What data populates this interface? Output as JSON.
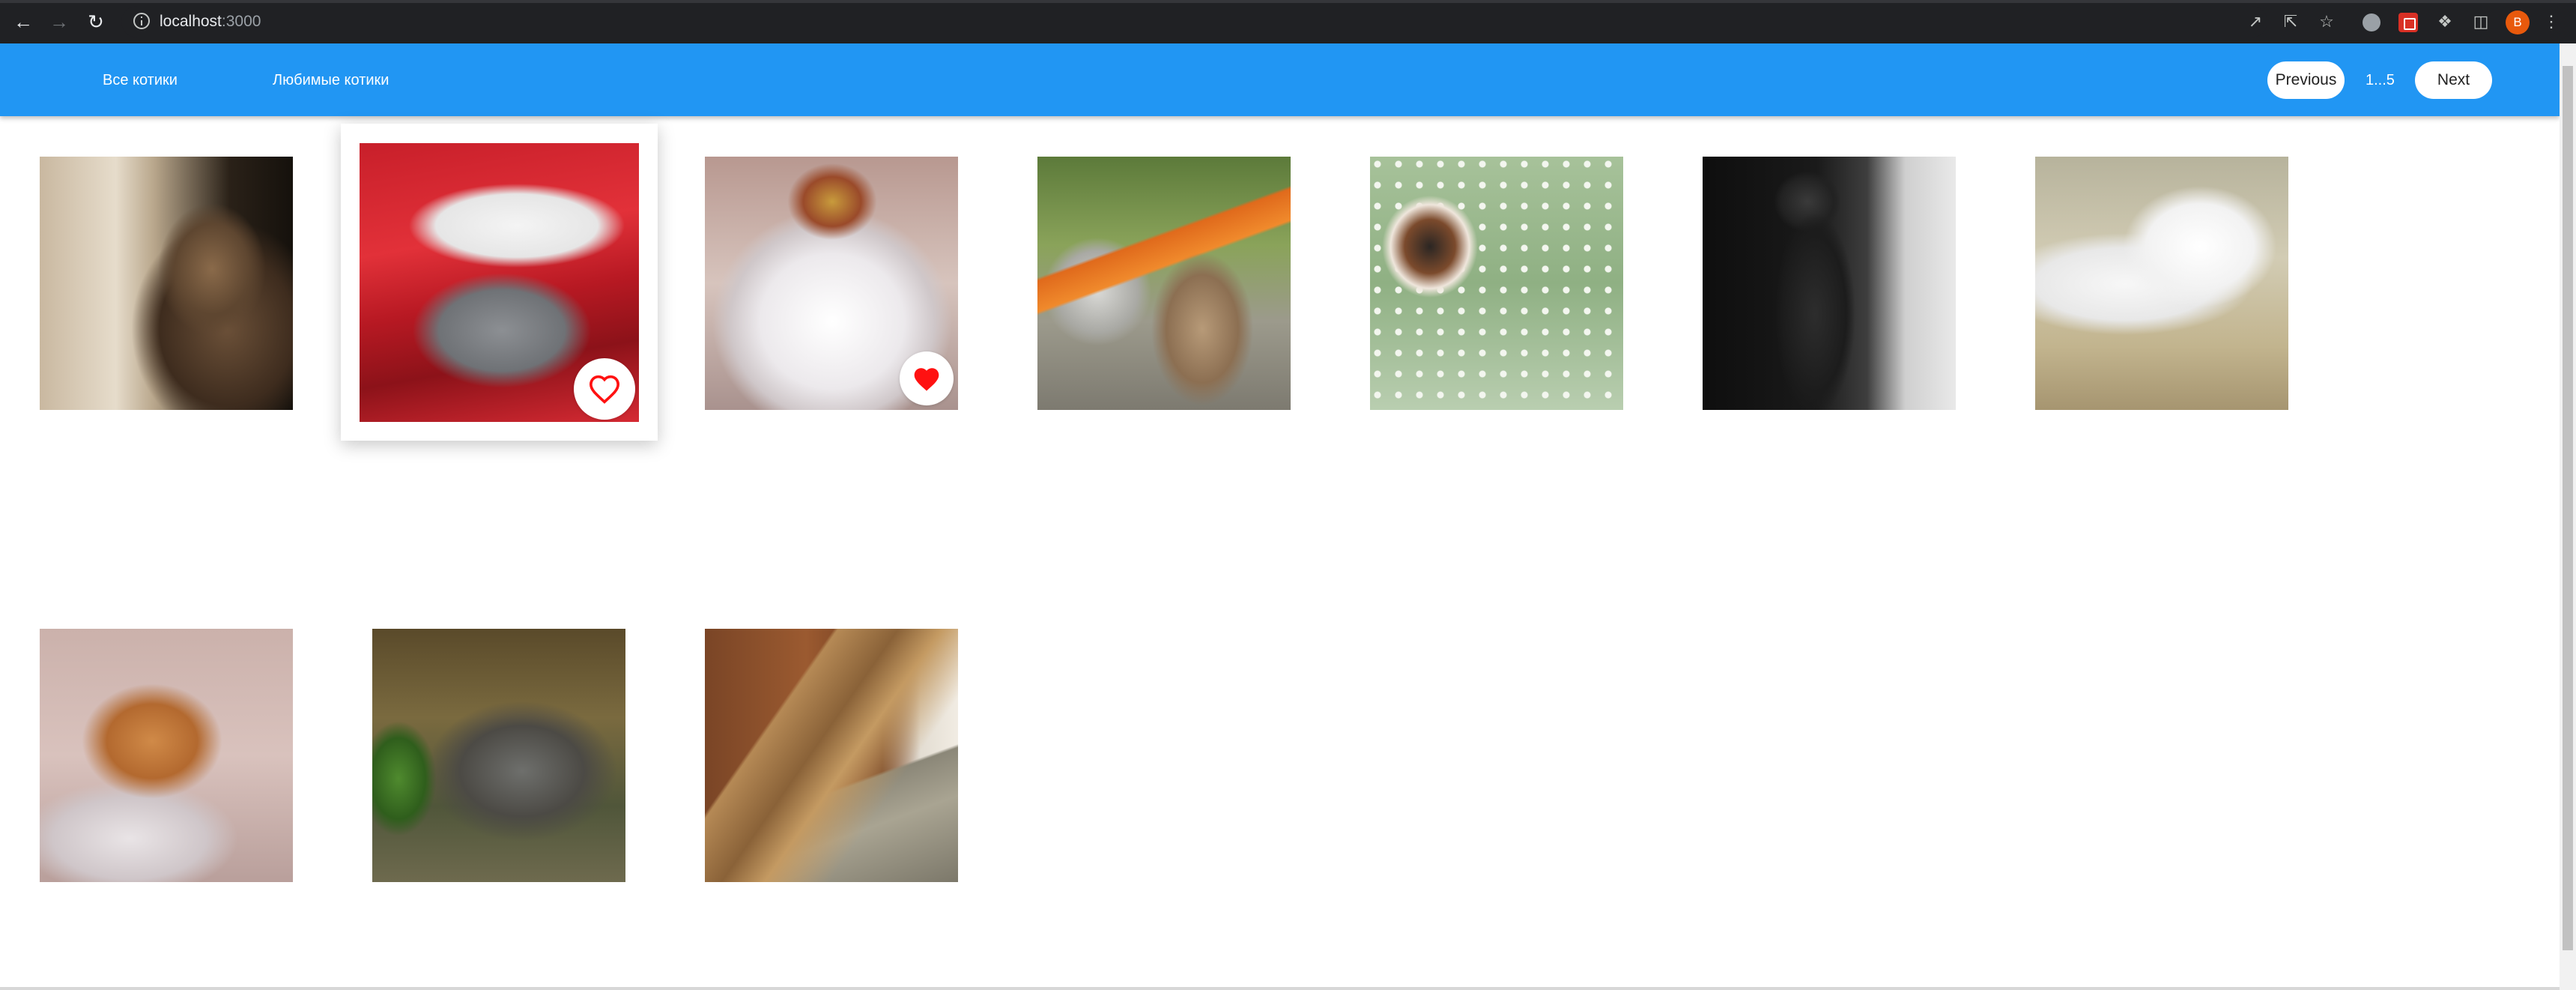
{
  "browser": {
    "url_host": "localhost",
    "url_port": ":3000",
    "profile_initial": "B"
  },
  "header": {
    "nav": [
      {
        "label": "Все котики"
      },
      {
        "label": "Любимые котики"
      }
    ],
    "pagination": {
      "previous_label": "Previous",
      "pages_label": "1...5",
      "next_label": "Next"
    }
  },
  "colors": {
    "header_bg": "#2196f3",
    "heart_active": "#ff1111"
  },
  "gallery": {
    "cats": [
      {
        "desc": "tabby cat beside bookshelf",
        "favorite": false
      },
      {
        "desc": "grey cat in santa hat",
        "favorite": false,
        "hovered": true
      },
      {
        "desc": "white persian with crown",
        "favorite": true
      },
      {
        "desc": "tabby cat near bicycle",
        "favorite": false
      },
      {
        "desc": "calico kitten on polka dots",
        "favorite": false
      },
      {
        "desc": "black and white sitting cat",
        "favorite": false
      },
      {
        "desc": "white cat with blue eyes lying",
        "favorite": false
      },
      {
        "desc": "ginger cat on pillow",
        "favorite": false
      },
      {
        "desc": "fluffy maine coon in grass",
        "favorite": false
      },
      {
        "desc": "bengal cat stretching",
        "favorite": false
      }
    ]
  }
}
